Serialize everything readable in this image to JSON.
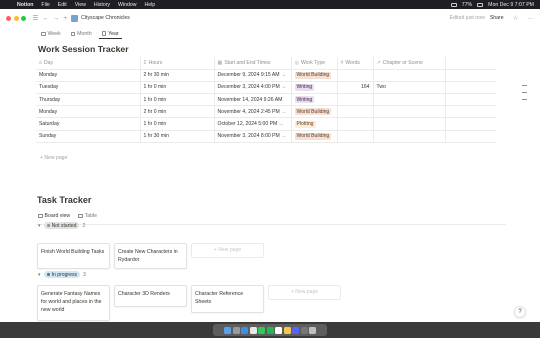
{
  "menubar": {
    "items": [
      "Notion",
      "File",
      "Edit",
      "View",
      "History",
      "Window",
      "Help"
    ],
    "battery": "77%",
    "clock": "Mon Dec 9  7:07 PM"
  },
  "topbar": {
    "page_title": "Cityscape Chronicles",
    "edited": "Edited just now",
    "share": "Share"
  },
  "view_tabs": [
    {
      "label": "Week"
    },
    {
      "label": "Month"
    },
    {
      "label": "Year"
    }
  ],
  "work_session": {
    "title": "Work Session Tracker",
    "columns": [
      "Day",
      "Hours",
      "Start and End Times",
      "Work Type",
      "Words",
      "Chapter or Scene"
    ],
    "rows": [
      {
        "day": "Monday",
        "hours": "2 hr 30 min",
        "times": "December 9, 2024 9:15 AM",
        "type": "World Building",
        "type_color": "wb",
        "words": "",
        "chapter": ""
      },
      {
        "day": "Tuesday",
        "hours": "1 hr 0 min",
        "times": "December 3, 2024 4:00 PM",
        "type": "Writing",
        "type_color": "wr",
        "words": "164",
        "chapter": "Two"
      },
      {
        "day": "Thursday",
        "hours": "1 hr 0 min",
        "times": "November 14, 2024 9:26 AM",
        "type": "Writing",
        "type_color": "wr",
        "words": "",
        "chapter": ""
      },
      {
        "day": "Monday",
        "hours": "2 hr 0 min",
        "times": "November 4, 2024 2:45 PM",
        "type": "World Building",
        "type_color": "wb",
        "words": "",
        "chapter": ""
      },
      {
        "day": "Saturday",
        "hours": "1 hr 0 min",
        "times": "October 12, 2024 5:00 PM",
        "type": "Plotting",
        "type_color": "pl",
        "words": "",
        "chapter": ""
      },
      {
        "day": "Sunday",
        "hours": "1 hr 30 min",
        "times": "November 3, 2024 8:00 PM",
        "type": "World Building",
        "type_color": "wb",
        "words": "",
        "chapter": ""
      }
    ],
    "new_page": "+ New page"
  },
  "task_tracker": {
    "title": "Task Tracker",
    "views": [
      "Board view",
      "Table"
    ],
    "groups": [
      {
        "name": "Not started",
        "count": "2",
        "cards": [
          "Finish World Building Tasks",
          "Create New Characters in Rydardor"
        ],
        "new_page": "+ New page"
      },
      {
        "name": "In progress",
        "count": "3",
        "cards": [
          "Generate Fantasy Names for world and places in the new world",
          "Character 3D Renders",
          "Character Reference Sheets"
        ],
        "new_page": "+ New page"
      }
    ]
  },
  "help": "?",
  "colors": {
    "world_building_bg": "#f5e0d5",
    "writing_bg": "#e8deee",
    "plotting_bg": "#fbecdd",
    "not_started_bg": "#e3e2e0",
    "in_progress_bg": "#d3e5ef"
  }
}
